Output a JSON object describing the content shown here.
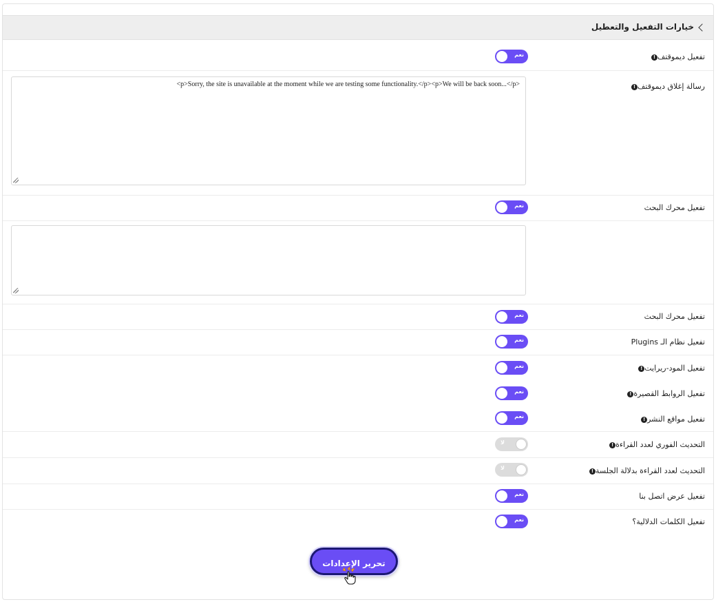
{
  "section": {
    "title": "خيارات التفعيل والتعطيل"
  },
  "rows": [
    {
      "label": "تفعيل ديموقتف",
      "info": true,
      "toggle": {
        "state": "on",
        "text": "نعم"
      }
    },
    {
      "label": "رسالة إغلاق ديموقتف",
      "info": true,
      "textarea": "<p>Sorry, the site is unavailable at the moment while we are testing some functionality.</p><p>We will be back soon...</p>"
    },
    {
      "label": "تفعيل محرك البحث",
      "info": false,
      "toggle": {
        "state": "on",
        "text": "نعم"
      }
    },
    {
      "label": "",
      "info": false,
      "textarea": ""
    },
    {
      "label": "تفعيل محرك البحث",
      "info": false,
      "toggle": {
        "state": "on",
        "text": "نعم"
      }
    },
    {
      "label": "تفعيل نظام الـ Plugins",
      "info": false,
      "toggle": {
        "state": "on",
        "text": "نعم"
      }
    },
    {
      "label": "تفعيل المود-ريرايت",
      "info": true,
      "toggle": {
        "state": "on",
        "text": "نعم"
      }
    },
    {
      "label": "تفعيل الروابط القصيرة",
      "info": true,
      "toggle": {
        "state": "on",
        "text": "نعم"
      }
    },
    {
      "label": "تفعيل مواقع النشر",
      "info": true,
      "toggle": {
        "state": "on",
        "text": "نعم"
      }
    },
    {
      "label": "التحديث الفوري لعدد القراءة",
      "info": true,
      "toggle": {
        "state": "off",
        "text": "لا"
      }
    },
    {
      "label": "التحديث لعدد القراءة بدلالة الجلسة",
      "info": true,
      "toggle": {
        "state": "off",
        "text": "لا"
      }
    },
    {
      "label": "تفعيل عرض اتصل بنا",
      "info": false,
      "toggle": {
        "state": "on",
        "text": "نعم"
      }
    },
    {
      "label": "تفعيل الكلمات الدلالية؟",
      "info": false,
      "toggle": {
        "state": "on",
        "text": "نعم"
      }
    }
  ],
  "save_button": {
    "label": "تحرير الإعدادات"
  },
  "colors": {
    "accent": "#6a4df5",
    "button_border": "#1c1873",
    "header_bg": "#eeeeee"
  },
  "icons": {
    "header": "chevron-left-icon",
    "info": "info-circle-icon",
    "cursor": "hand-pointer-icon"
  }
}
